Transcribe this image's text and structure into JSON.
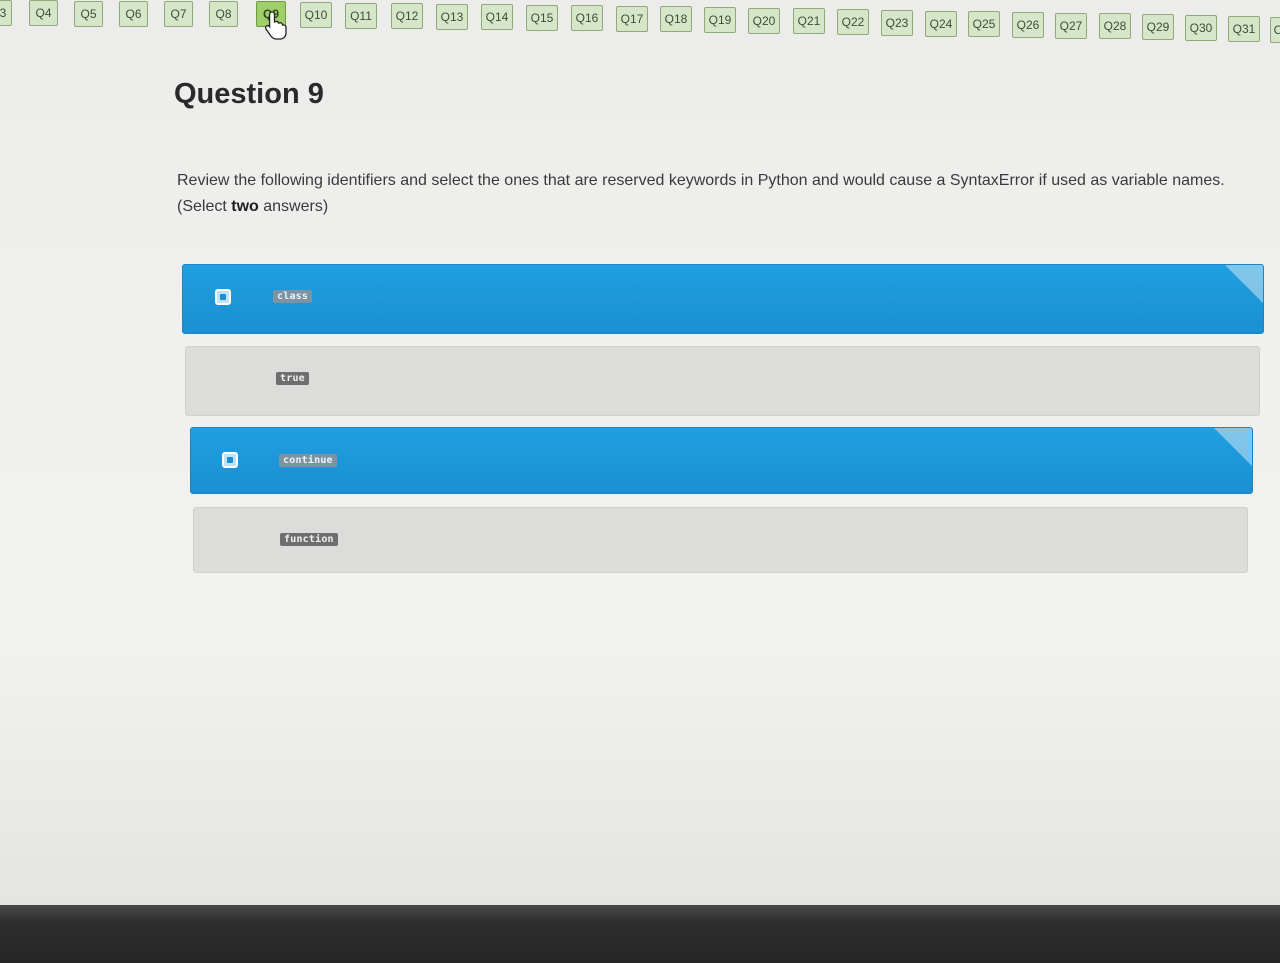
{
  "nav": {
    "items": [
      {
        "label": "3"
      },
      {
        "label": "Q4"
      },
      {
        "label": "Q5"
      },
      {
        "label": "Q6"
      },
      {
        "label": "Q7"
      },
      {
        "label": "Q8"
      },
      {
        "label": "Q9",
        "current": true
      },
      {
        "label": "Q10"
      },
      {
        "label": "Q11"
      },
      {
        "label": "Q12"
      },
      {
        "label": "Q13"
      },
      {
        "label": "Q14"
      },
      {
        "label": "Q15"
      },
      {
        "label": "Q16"
      },
      {
        "label": "Q17"
      },
      {
        "label": "Q18"
      },
      {
        "label": "Q19"
      },
      {
        "label": "Q20"
      },
      {
        "label": "Q21"
      },
      {
        "label": "Q22"
      },
      {
        "label": "Q23"
      },
      {
        "label": "Q24"
      },
      {
        "label": "Q25"
      },
      {
        "label": "Q26"
      },
      {
        "label": "Q27"
      },
      {
        "label": "Q28"
      },
      {
        "label": "Q29"
      },
      {
        "label": "Q30"
      },
      {
        "label": "Q31"
      },
      {
        "label": "C"
      }
    ]
  },
  "question": {
    "title": "Question 9",
    "prompt_before": "Review the following identifiers and select the ones that are reserved keywords in Python and would cause a SyntaxError if used as variable names. (Select ",
    "prompt_bold": "two",
    "prompt_after": " answers)"
  },
  "options": [
    {
      "label": "class",
      "selected": true
    },
    {
      "label": "true",
      "selected": false
    },
    {
      "label": "continue",
      "selected": true
    },
    {
      "label": "function",
      "selected": false
    }
  ],
  "colors": {
    "selected": "#1b8fd2",
    "unselected": "#dcdcda",
    "nav_button": "#d7e5c8",
    "nav_current": "#9fcf6a"
  }
}
